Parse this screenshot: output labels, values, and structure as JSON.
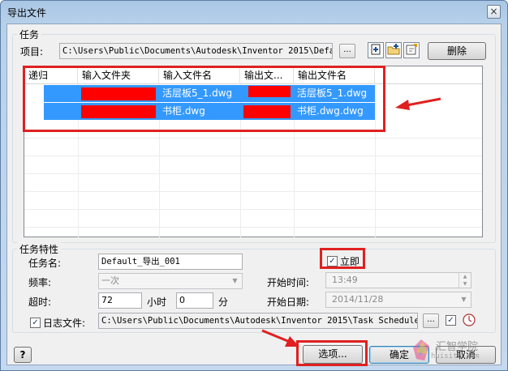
{
  "window": {
    "title": "导出文件",
    "close_glyph": "×"
  },
  "task_group": {
    "label": "任务",
    "project_label": "项目:",
    "project_path": "C:\\Users\\Public\\Documents\\Autodesk\\Inventor 2015\\Defaul",
    "browse_label": "...",
    "delete_label": "删除",
    "icons": [
      "add-task-icon",
      "add-folder-icon",
      "edit-task-icon"
    ]
  },
  "table": {
    "columns": [
      "递归",
      "输入文件夹",
      "输入文件名",
      "输出文...",
      "输出文件名"
    ],
    "rows": [
      {
        "input_name": "活层板5_1.dwg",
        "output_name": "活层板5_1.dwg",
        "selected": true
      },
      {
        "input_name": "书柜.dwg",
        "output_name": "书柜.dwg.dwg",
        "selected": true
      }
    ]
  },
  "props_group": {
    "label": "任务特性",
    "task_name_label": "任务名:",
    "task_name_value": "Default_导出_001",
    "frequency_label": "频率:",
    "frequency_value": "一次",
    "timeout_label": "超时:",
    "timeout_hours": "72",
    "hours_label": "小时",
    "timeout_minutes": "0",
    "minutes_label": "分",
    "immediate_label": "立即",
    "immediate_checked": "✓",
    "start_time_label": "开始时间:",
    "start_time_value": "13:49",
    "start_date_label": "开始日期:",
    "start_date_value": "2014/11/28",
    "log_label": "日志文件:",
    "log_checked": "✓",
    "log_path": "C:\\Users\\Public\\Documents\\Autodesk\\Inventor 2015\\Task Scheduler l",
    "log_browse": "...",
    "log_view_checked": "✓"
  },
  "footer": {
    "help_label": "?",
    "options_label": "选项...",
    "ok_label": "确定",
    "cancel_label": "取消"
  },
  "watermark": {
    "text_cn": "汇智学院",
    "text_en": "huisite.com"
  },
  "colors": {
    "highlight_red": "#e02020",
    "selection_blue": "#3399ff"
  }
}
